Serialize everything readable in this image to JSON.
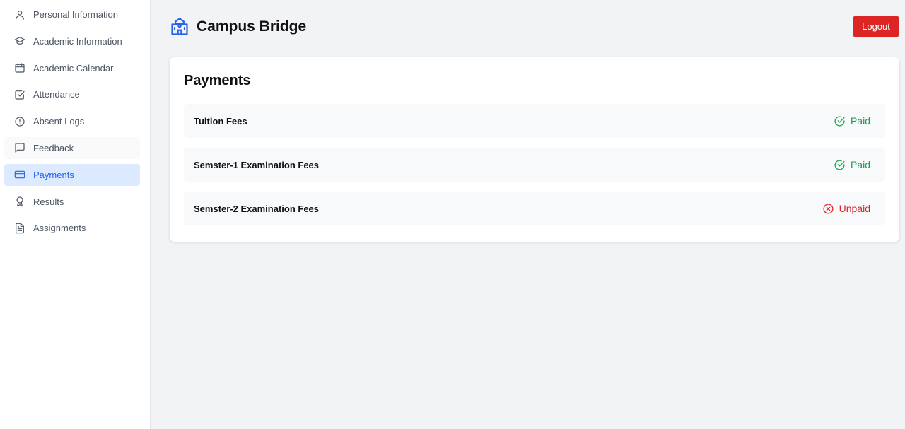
{
  "sidebar": {
    "items": [
      {
        "label": "Personal Information",
        "icon": "user-icon"
      },
      {
        "label": "Academic Information",
        "icon": "graduation-cap-icon"
      },
      {
        "label": "Academic Calendar",
        "icon": "calendar-icon"
      },
      {
        "label": "Attendance",
        "icon": "checkbox-icon"
      },
      {
        "label": "Absent Logs",
        "icon": "alert-circle-icon"
      },
      {
        "label": "Feedback",
        "icon": "message-square-icon"
      },
      {
        "label": "Payments",
        "icon": "credit-card-icon",
        "active": true
      },
      {
        "label": "Results",
        "icon": "award-icon"
      },
      {
        "label": "Assignments",
        "icon": "file-text-icon"
      }
    ]
  },
  "header": {
    "title": "Campus Bridge",
    "icon": "school-icon",
    "logout_label": "Logout"
  },
  "payments": {
    "title": "Payments",
    "rows": [
      {
        "name": "Tuition Fees",
        "status": "Paid",
        "status_icon": "check-circle-icon"
      },
      {
        "name": "Semster-1 Examination Fees",
        "status": "Paid",
        "status_icon": "check-circle-icon"
      },
      {
        "name": "Semster-2 Examination Fees",
        "status": "Unpaid",
        "status_icon": "x-circle-icon"
      }
    ]
  },
  "colors": {
    "accent": "#2563eb",
    "danger": "#dc2626",
    "success": "#16a34a",
    "active_bg": "#dbeafe"
  }
}
